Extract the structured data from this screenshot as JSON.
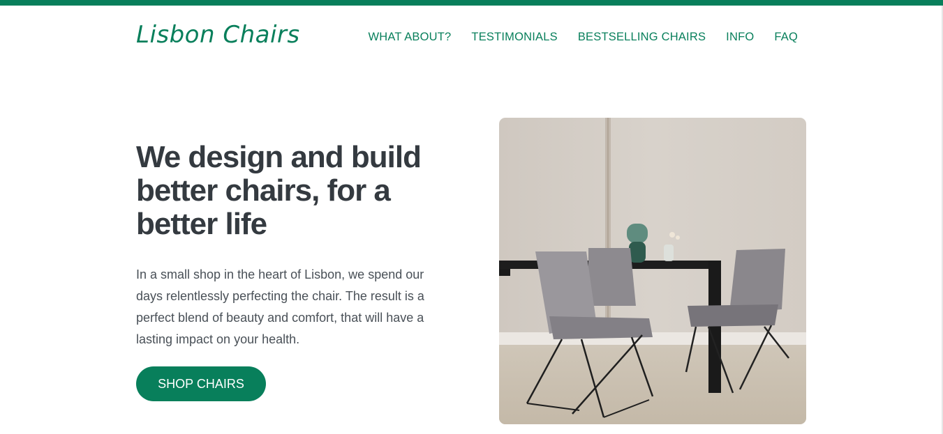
{
  "brand": {
    "name": "Lisbon Chairs",
    "accent": "#087f5b"
  },
  "nav": {
    "items": [
      {
        "label": "WHAT ABOUT?"
      },
      {
        "label": "TESTIMONIALS"
      },
      {
        "label": "BESTSELLING CHAIRS"
      },
      {
        "label": "INFO"
      },
      {
        "label": "FAQ"
      }
    ]
  },
  "hero": {
    "title": "We design and build better chairs, for a better life",
    "description": "In a small shop in the heart of Lisbon, we spend our days relentlessly perfecting the chair. The result is a perfect blend of beauty and comfort, that will have a lasting impact on your health.",
    "cta_label": "SHOP CHAIRS",
    "image_icon": "chairs-dining-photo"
  }
}
